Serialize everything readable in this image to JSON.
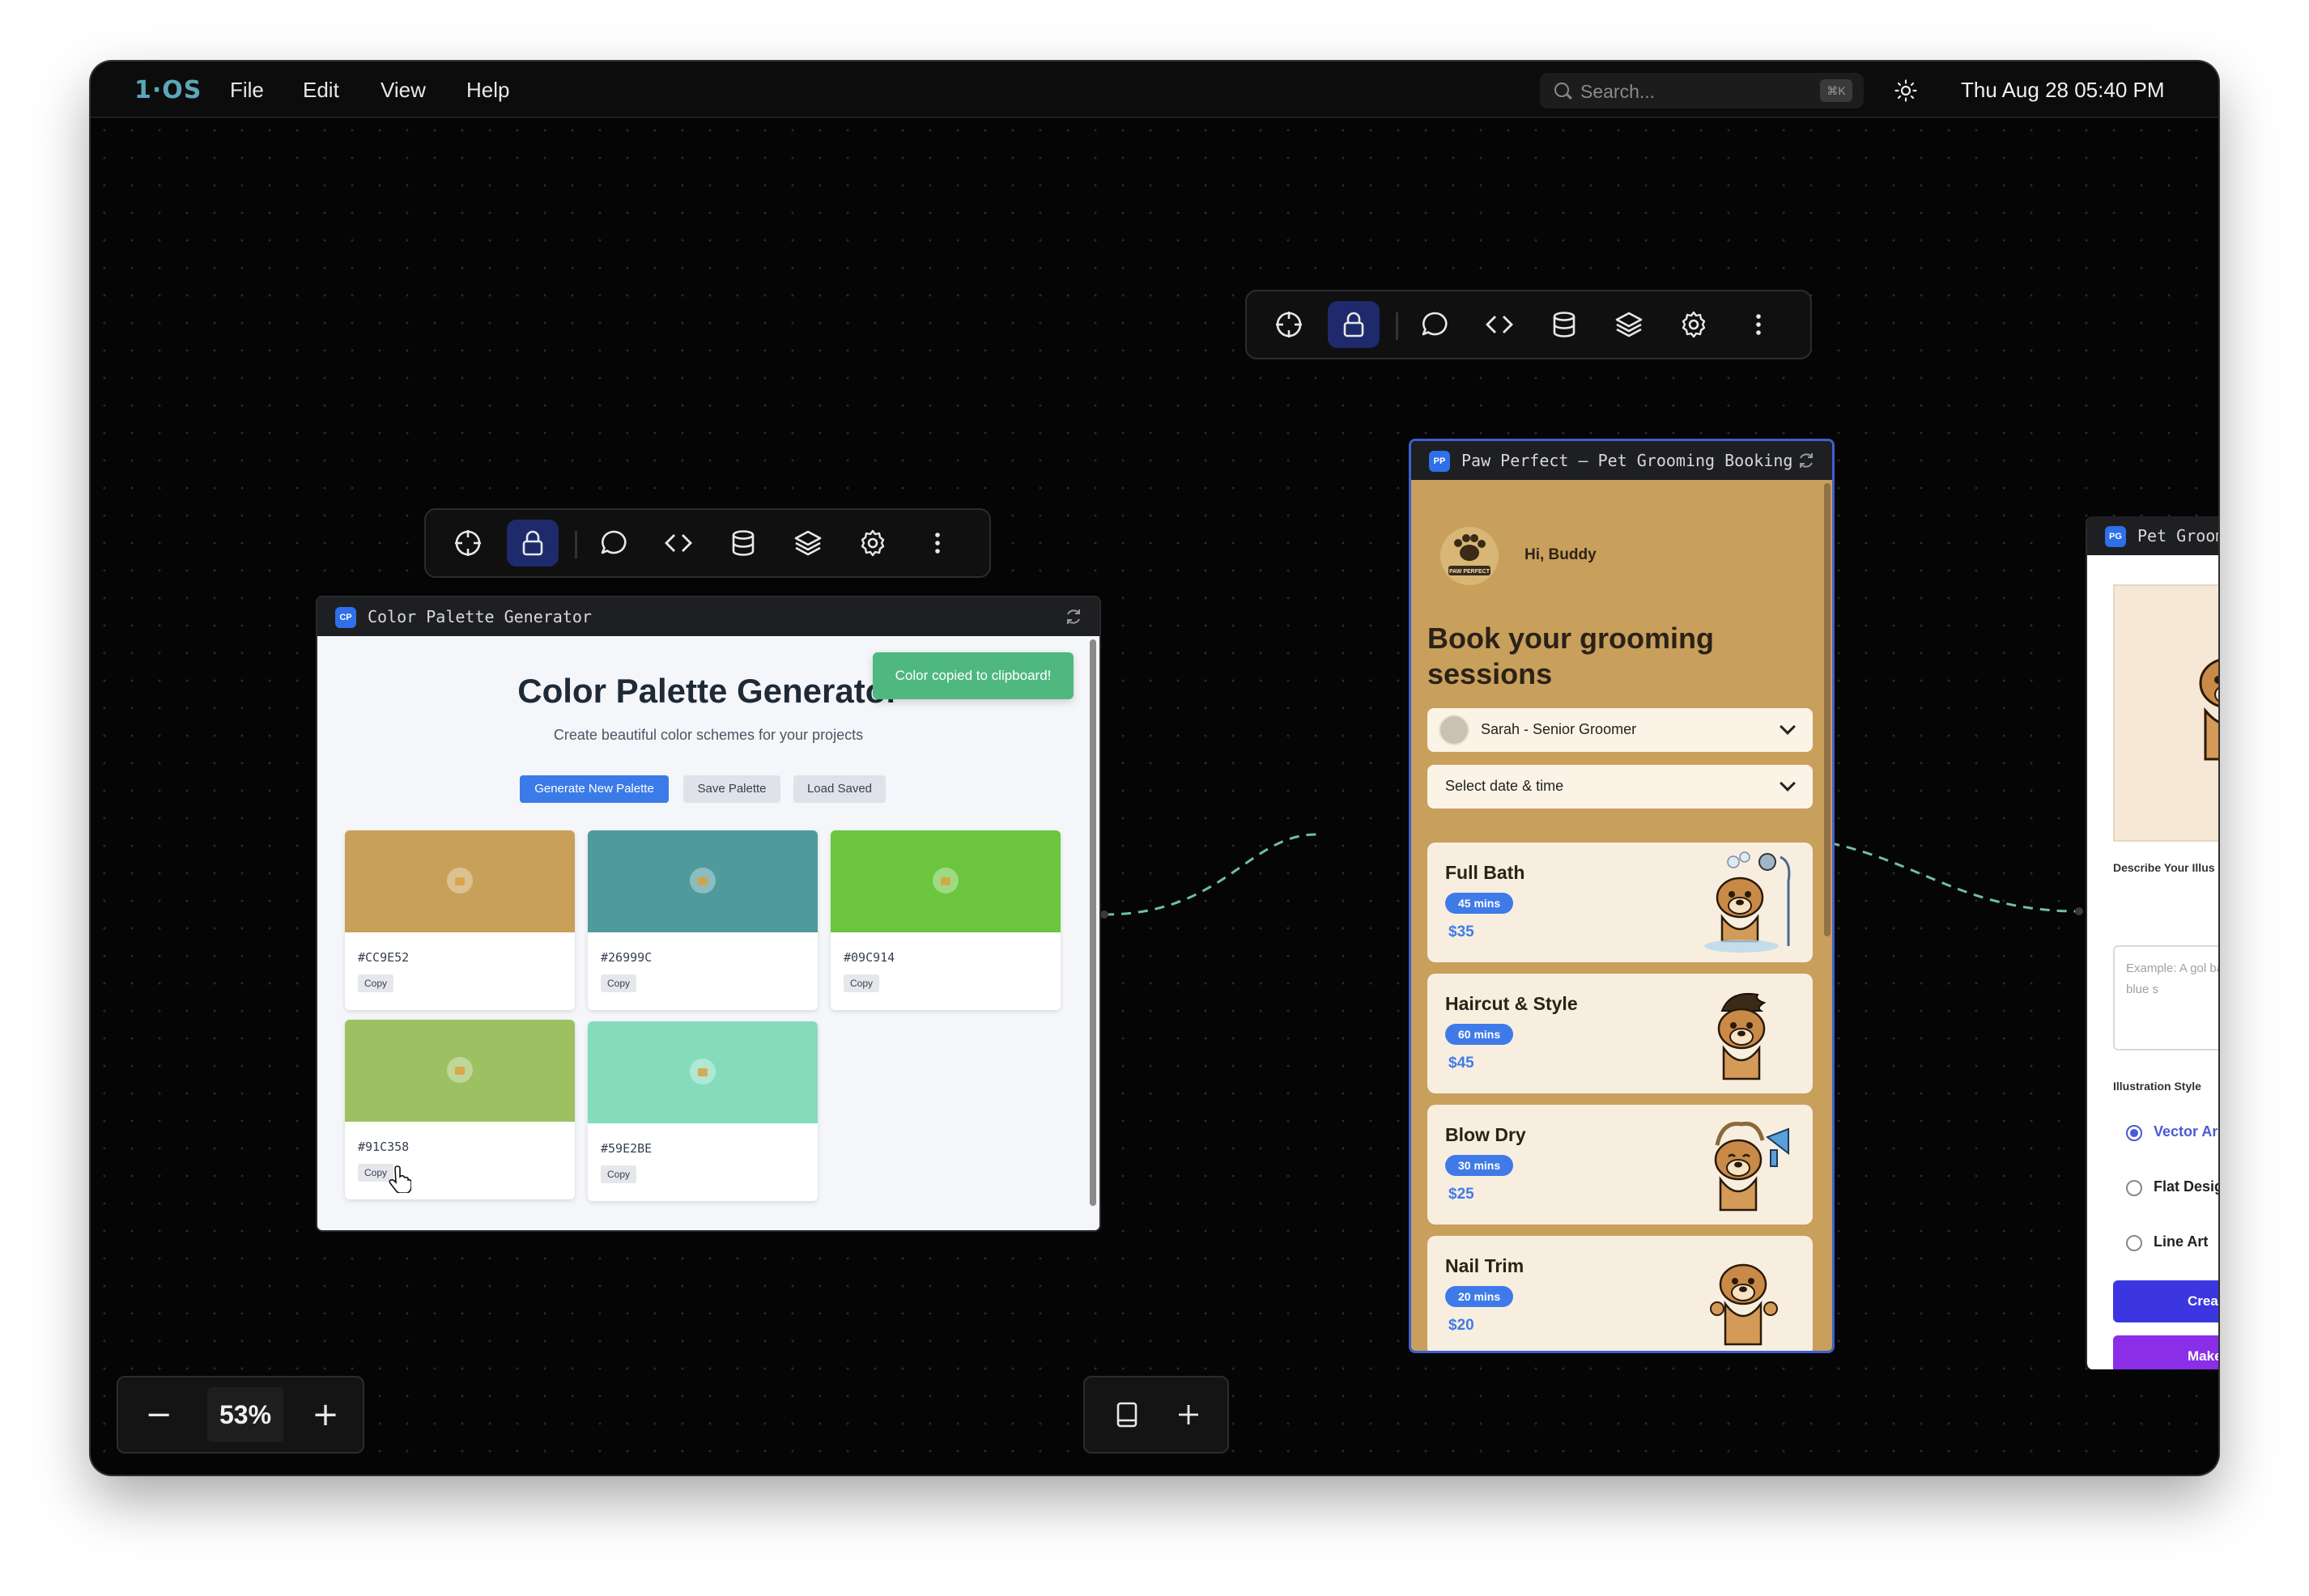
{
  "menubar": {
    "logo": "1·OS",
    "menus": [
      "File",
      "Edit",
      "View",
      "Help"
    ],
    "search_placeholder": "Search...",
    "search_shortcut": "⌘K",
    "datetime": "Thu Aug 28 05:40 PM"
  },
  "toolbar_icons": [
    "crosshair-icon",
    "lock-icon",
    "chat-icon",
    "code-icon",
    "database-icon",
    "layers-icon",
    "gear-icon",
    "more-vertical-icon"
  ],
  "palette_window": {
    "badge": "CP",
    "title": "Color Palette Generator",
    "heading": "Color Palette Generator",
    "subtitle": "Create beautiful color schemes for your projects",
    "toast": "Color copied to clipboard!",
    "buttons": {
      "generate": "Generate New Palette",
      "save": "Save Palette",
      "load": "Load Saved"
    },
    "copy_label": "Copy",
    "colors": [
      {
        "hex": "#CC9E52",
        "color": "#c9a05a"
      },
      {
        "hex": "#26999C",
        "color": "#4f9a9c"
      },
      {
        "hex": "#09C914",
        "color": "#6bc63e"
      },
      {
        "hex": "#91C358",
        "color": "#9dc063"
      },
      {
        "hex": "#59E2BE",
        "color": "#84dcbd"
      }
    ]
  },
  "booking_window": {
    "badge": "PP",
    "title": "Paw Perfect – Pet Grooming Booking",
    "greeting": "Hi, Buddy",
    "logo_text": "PAW PERFECT",
    "heading": "Book your grooming sessions",
    "groomer_select": "Sarah - Senior Groomer",
    "datetime_select": "Select date & time",
    "services": [
      {
        "name": "Full Bath",
        "duration": "45 mins",
        "price": "$35"
      },
      {
        "name": "Haircut & Style",
        "duration": "60 mins",
        "price": "$45"
      },
      {
        "name": "Blow Dry",
        "duration": "30 mins",
        "price": "$25"
      },
      {
        "name": "Nail Trim",
        "duration": "20 mins",
        "price": "$20"
      }
    ]
  },
  "illustration_window": {
    "badge": "PG",
    "title": "Pet Groom",
    "describe_label": "Describe Your Illus",
    "textarea_placeholder": "Example: A gol bath with blue s",
    "style_label": "Illustration Style",
    "styles": [
      {
        "label": "Vector Ar",
        "selected": true
      },
      {
        "label": "Flat Desig",
        "selected": false
      },
      {
        "label": "Line Art",
        "selected": false
      }
    ],
    "create_button": "Crea",
    "make_button": "Make"
  },
  "zoom": {
    "value": "53%",
    "minus": "−",
    "plus": "+"
  },
  "colors": {
    "accent": "#1e2a6b",
    "link_line": "#6fbfa0",
    "booking_bg": "#c99f5c",
    "price_blue": "#3f7be8"
  }
}
